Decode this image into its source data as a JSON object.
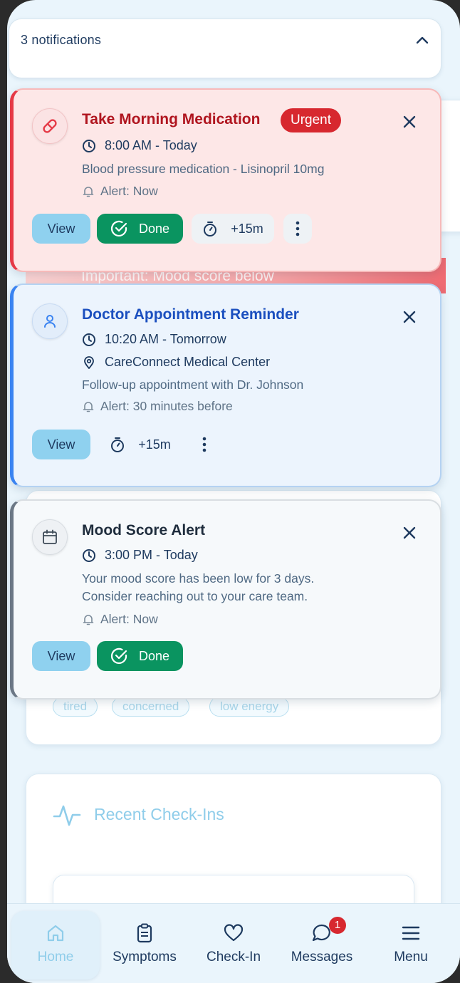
{
  "notifications_header": {
    "count_label": "3 notifications"
  },
  "notifications": [
    {
      "title": "Take Morning Medication",
      "badge": "Urgent",
      "time": "8:00 AM - Today",
      "description": "Blood pressure medication - Lisinopril 10mg",
      "alert": "Alert: Now",
      "actions": {
        "view": "View",
        "done": "Done",
        "snooze": "+15m"
      }
    },
    {
      "title": "Doctor Appointment Reminder",
      "time": "10:20 AM - Tomorrow",
      "location": "CareConnect Medical Center",
      "description": "Follow-up appointment with Dr. Johnson",
      "alert": "Alert: 30 minutes before",
      "actions": {
        "view": "View",
        "snooze": "+15m"
      }
    },
    {
      "title": "Mood Score Alert",
      "time": "3:00 PM - Today",
      "description_line1": "Your mood score has been low for 3 days.",
      "description_line2": "Consider reaching out to your care team.",
      "alert": "Alert: Now",
      "actions": {
        "view": "View",
        "done": "Done"
      }
    }
  ],
  "background": {
    "important_text": "Important: Mood score below",
    "tags": [
      "tired",
      "concerned",
      "low energy"
    ],
    "recent_title": "Recent Check-Ins"
  },
  "bottom_nav": {
    "items": [
      {
        "label": "Home",
        "icon": "home-icon",
        "active": true
      },
      {
        "label": "Symptoms",
        "icon": "clipboard-icon"
      },
      {
        "label": "Check-In",
        "icon": "heart-icon"
      },
      {
        "label": "Messages",
        "icon": "chat-icon",
        "badge": "1"
      },
      {
        "label": "Menu",
        "icon": "menu-icon"
      }
    ]
  },
  "colors": {
    "urgent": "#e53946",
    "info": "#3a83f1",
    "neutral": "#6b7785",
    "done": "#0a9460",
    "view": "#8fd1ef"
  }
}
